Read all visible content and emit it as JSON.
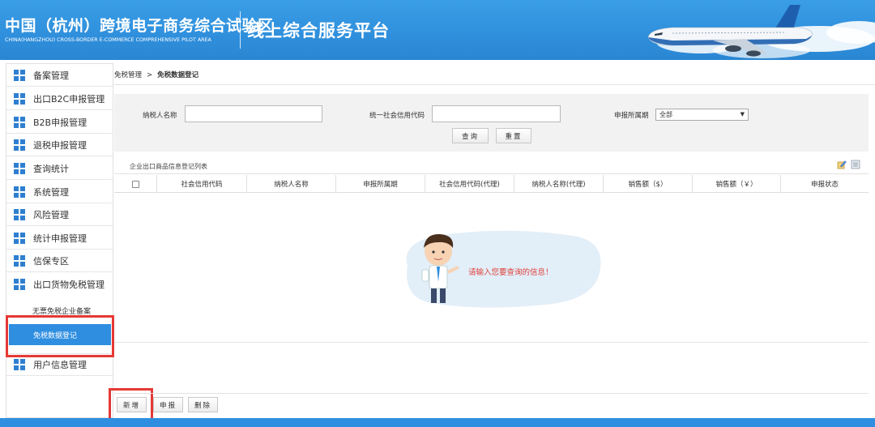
{
  "header": {
    "title_cn": "中国（杭州）跨境电子商务综合试验区",
    "title_en": "CHINA(HANGZHOU)  CROSS-BORDER E-COMMERCE COMPREHENSIVE PILOT AREA",
    "platform_title": "线上综合服务平台"
  },
  "sidebar": {
    "items": [
      {
        "label": "备案管理"
      },
      {
        "label": "出口B2C申报管理"
      },
      {
        "label": "B2B申报管理"
      },
      {
        "label": "退税申报管理"
      },
      {
        "label": "查询统计"
      },
      {
        "label": "系统管理"
      },
      {
        "label": "风险管理"
      },
      {
        "label": "统计申报管理"
      },
      {
        "label": "信保专区"
      },
      {
        "label": "出口货物免税管理"
      }
    ],
    "sub_items": [
      {
        "label": "无票免税企业备案"
      },
      {
        "label": "免税数据登记"
      }
    ],
    "last_item": {
      "label": "用户信息管理"
    }
  },
  "breadcrumb": {
    "parent": "免税管理",
    "separator": ">",
    "current": "免税数据登记"
  },
  "search": {
    "taxpayer_label": "纳税人名称",
    "taxpayer_value": "",
    "credit_code_label": "统一社会信用代码",
    "credit_code_value": "",
    "period_label": "申报所属期",
    "period_selected": "全部",
    "query_button": "查询",
    "reset_button": "重置"
  },
  "list": {
    "title": "企业出口商品信息登记列表",
    "columns": [
      "社会信用代码",
      "纳税人名称",
      "申报所属期",
      "社会信用代码(代理)",
      "纳税人名称(代理)",
      "销售额（$）",
      "销售额（￥）",
      "申报状态"
    ],
    "rows": [],
    "empty_message": "请输入您要查询的信息！"
  },
  "actions": {
    "add_button": "新增",
    "declare_button": "申报",
    "delete_button": "删除"
  },
  "colors": {
    "brand_blue": "#2f8ee0",
    "highlight_red": "#e53935",
    "empty_message": "#e0403a"
  }
}
